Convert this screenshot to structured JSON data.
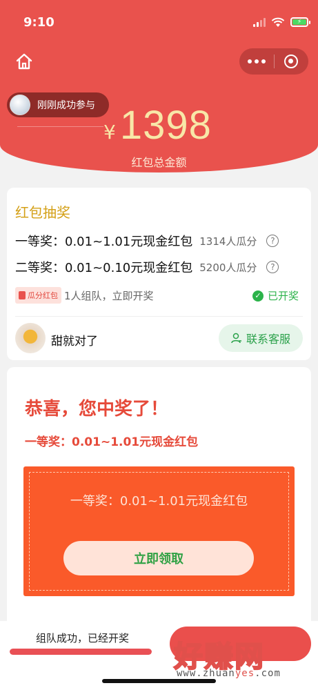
{
  "status_bar": {
    "time": "9:10"
  },
  "header": {
    "currency_symbol": "¥",
    "total_amount": "1398",
    "amount_label": "红包总金额",
    "ticker_text": "刚刚成功参与",
    "colors": {
      "primary_red": "#e9524d",
      "amount_gold": "#f8e7a8"
    }
  },
  "lottery": {
    "title": "红包抽奖",
    "prizes": [
      {
        "label": "一等奖：0.01~1.01元现金红包",
        "count": "1314人瓜分"
      },
      {
        "label": "二等奖：0.01~0.10元现金红包",
        "count": "5200人瓜分"
      }
    ],
    "tag_label": "瓜分红包",
    "tag_desc": "1人组队，立即开奖",
    "opened_label": "已开奖",
    "user_name": "甜就对了",
    "service_button": "联系客服"
  },
  "result": {
    "congrats": "恭喜，您中奖了！",
    "won_prize": "一等奖：0.01~1.01元现金红包",
    "box_text": "一等奖：0.01~1.01元现金红包",
    "claim_button": "立即领取"
  },
  "bottom": {
    "status_text": "组队成功，已经开奖",
    "progress": 1.0
  },
  "watermark": {
    "main": "好赚网",
    "url_prefix": "www.zhuan",
    "url_highlight": "yes",
    "url_suffix": ".com"
  }
}
